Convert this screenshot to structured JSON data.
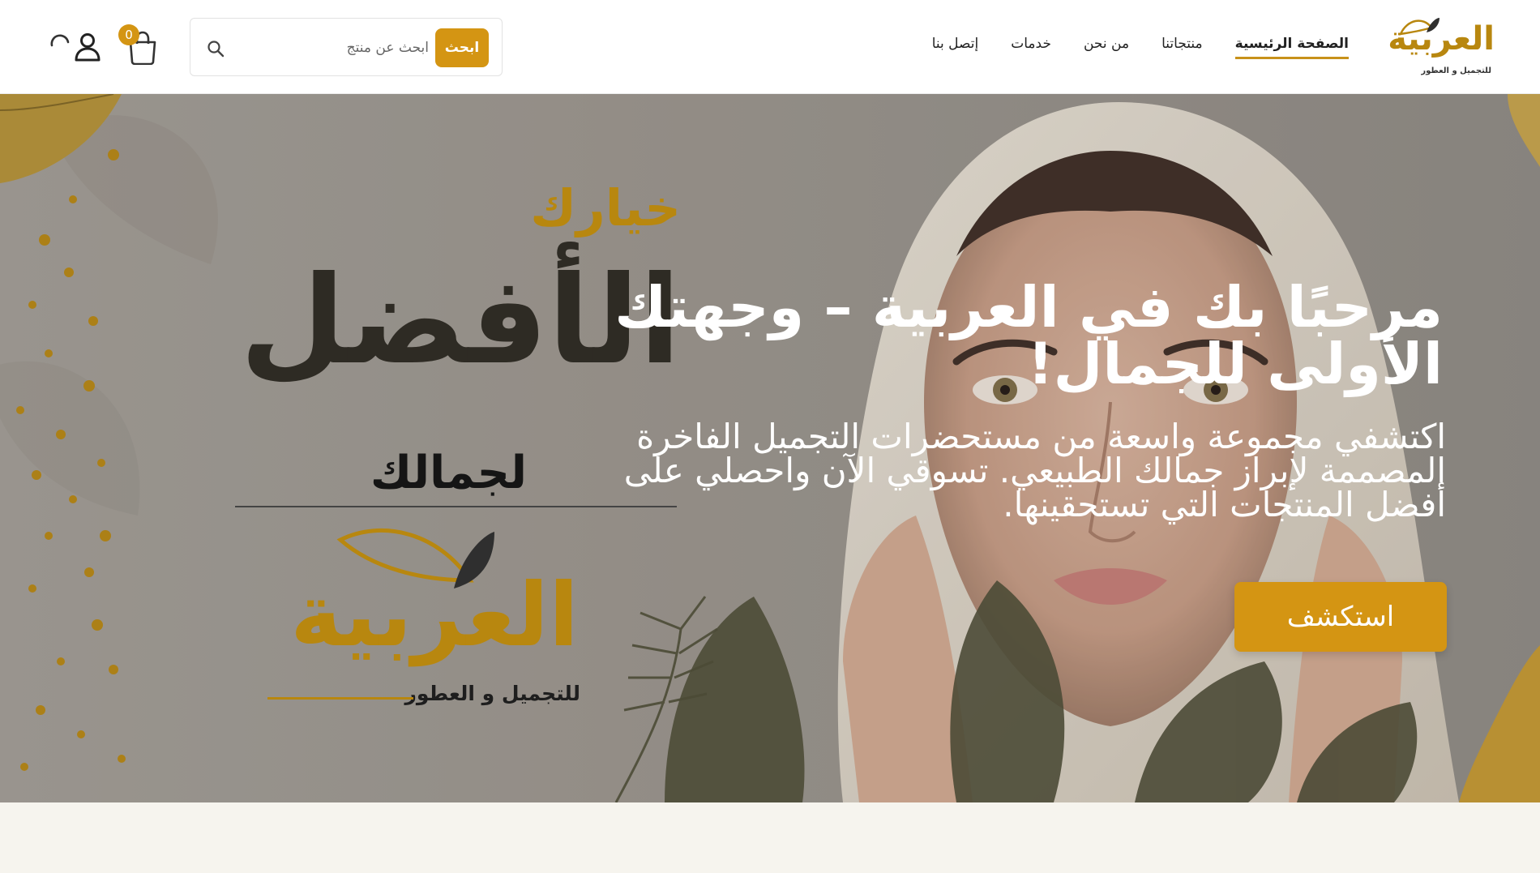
{
  "brand": {
    "logo_text": "العربية",
    "logo_sub": "للتجميل و العطور",
    "accent": "#d49513"
  },
  "nav": {
    "items": [
      {
        "label": "الصفحة الرئيسية",
        "active": true
      },
      {
        "label": "منتجاتنا",
        "active": false
      },
      {
        "label": "من نحن",
        "active": false
      },
      {
        "label": "خدمات",
        "active": false
      },
      {
        "label": "إتصل بنا",
        "active": false
      }
    ]
  },
  "search": {
    "placeholder": "ابحث عن منتج",
    "button_label": "ابحث",
    "icon": "search-icon"
  },
  "cart": {
    "count": "0",
    "icon": "shopping-bag-icon"
  },
  "account": {
    "icon": "user-icon",
    "loading_icon": "spinner-icon"
  },
  "hero": {
    "promo_top": "خيارك",
    "promo_main": "الأفضل",
    "promo_bottom": "لجمالك",
    "promo_logo_text": "العربية",
    "promo_logo_sub": "للتجميل و العطور",
    "title": "مرحبًا بك في العربية – وجهتك الأولى للجمال!",
    "description": "اكتشفي مجموعة واسعة من مستحضرات التجميل الفاخرة المصممة لإبراز جمالك الطبيعي. تسوقي الآن واحصلي على أفضل المنتجات التي تستحقينها.",
    "cta_label": "استكشف"
  }
}
